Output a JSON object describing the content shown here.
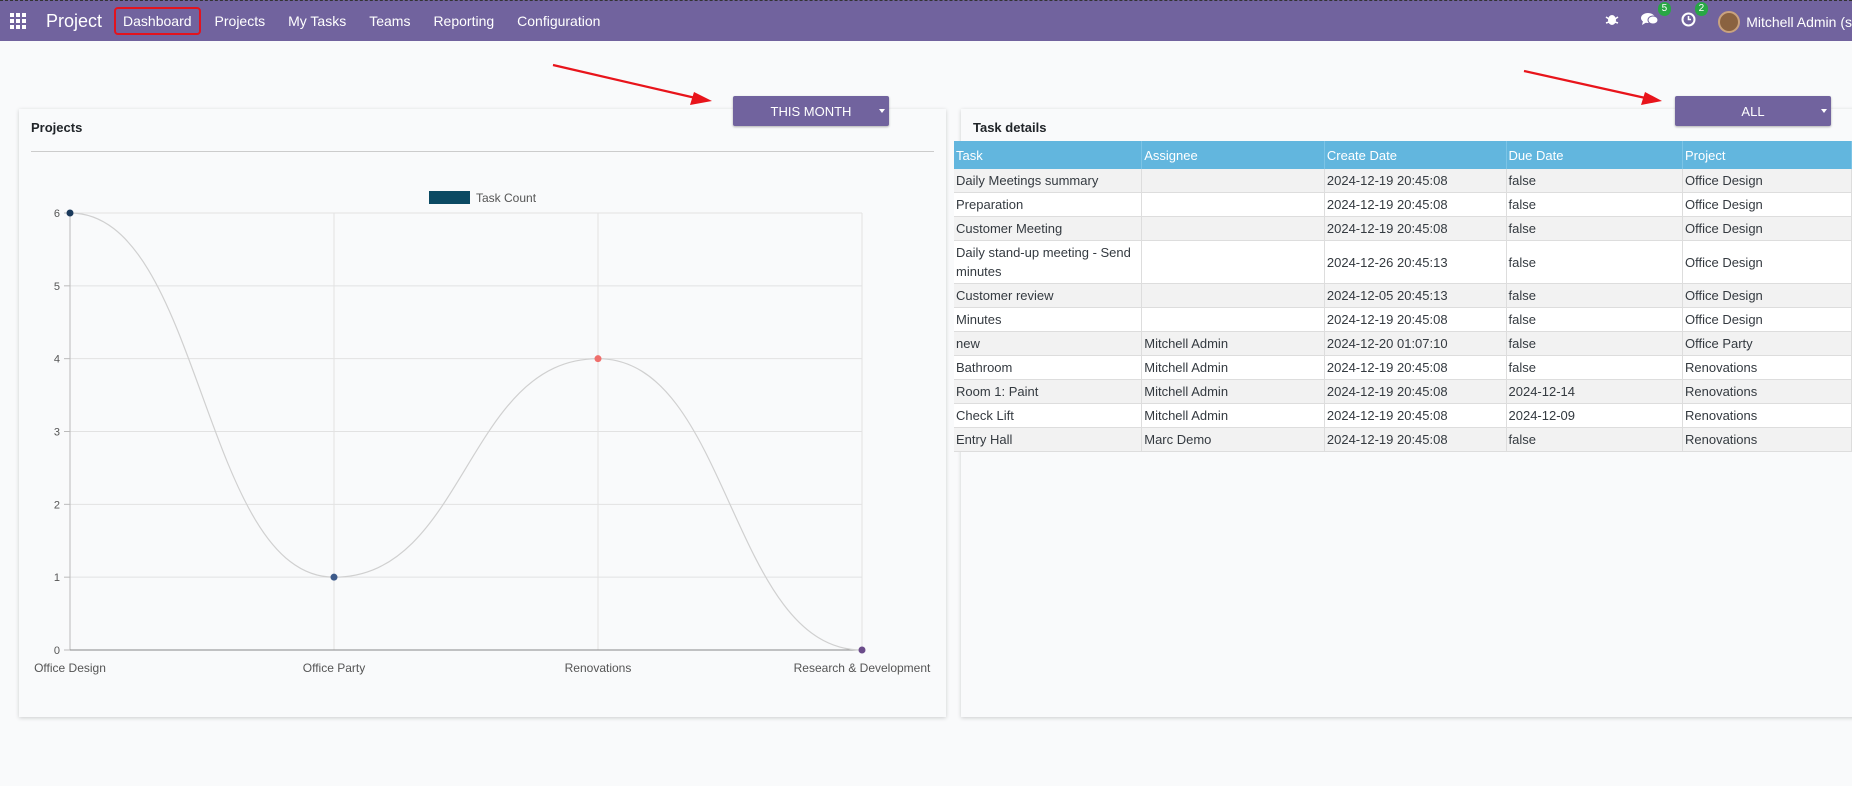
{
  "navbar": {
    "brand": "Project",
    "menu": [
      {
        "label": "Dashboard",
        "active": true
      },
      {
        "label": "Projects"
      },
      {
        "label": "My Tasks"
      },
      {
        "label": "Teams"
      },
      {
        "label": "Reporting"
      },
      {
        "label": "Configuration"
      }
    ],
    "icons": [
      "apps-grid-icon",
      "bug-icon",
      "chat-icon",
      "clock-icon"
    ],
    "chat_badge": "5",
    "activity_badge": "2",
    "user_name": "Mitchell Admin (s",
    "color": "#71639e"
  },
  "projects_card": {
    "title": "Projects",
    "filter_label": "THIS MONTH"
  },
  "tasks_card": {
    "title": "Task details",
    "filter_label": "ALL",
    "columns": [
      "Task",
      "Assignee",
      "Create Date",
      "Due Date",
      "Project"
    ],
    "rows": [
      [
        "Daily Meetings summary",
        "",
        "2024-12-19 20:45:08",
        "false",
        "Office Design"
      ],
      [
        "Preparation",
        "",
        "2024-12-19 20:45:08",
        "false",
        "Office Design"
      ],
      [
        "Customer Meeting",
        "",
        "2024-12-19 20:45:08",
        "false",
        "Office Design"
      ],
      [
        "Daily stand-up meeting - Send minutes",
        "",
        "2024-12-26 20:45:13",
        "false",
        "Office Design"
      ],
      [
        "Customer review",
        "",
        "2024-12-05 20:45:13",
        "false",
        "Office Design"
      ],
      [
        "Minutes",
        "",
        "2024-12-19 20:45:08",
        "false",
        "Office Design"
      ],
      [
        "new",
        "Mitchell Admin",
        "2024-12-20 01:07:10",
        "false",
        "Office Party"
      ],
      [
        "Bathroom",
        "Mitchell Admin",
        "2024-12-19 20:45:08",
        "false",
        "Renovations"
      ],
      [
        "Room 1: Paint",
        "Mitchell Admin",
        "2024-12-19 20:45:08",
        "2024-12-14",
        "Renovations"
      ],
      [
        "Check Lift",
        "Mitchell Admin",
        "2024-12-19 20:45:08",
        "2024-12-09",
        "Renovations"
      ],
      [
        "Entry Hall",
        "Marc Demo",
        "2024-12-19 20:45:08",
        "false",
        "Renovations"
      ]
    ]
  },
  "chart_data": {
    "type": "line",
    "categories": [
      "Office Design",
      "Office Party",
      "Renovations",
      "Research & Development"
    ],
    "series": [
      {
        "name": "Task Count",
        "values": [
          6,
          1,
          4,
          0
        ]
      }
    ],
    "point_colors": [
      "#1b3a5c",
      "#3d5a8a",
      "#ef6f6c",
      "#6b4c8a"
    ],
    "legend_color": "#0b4a63",
    "ylim": [
      0,
      6
    ],
    "yticks": [
      "0",
      "1",
      "2",
      "3",
      "4",
      "5",
      "6"
    ],
    "grid": true,
    "legend_position": "top"
  }
}
